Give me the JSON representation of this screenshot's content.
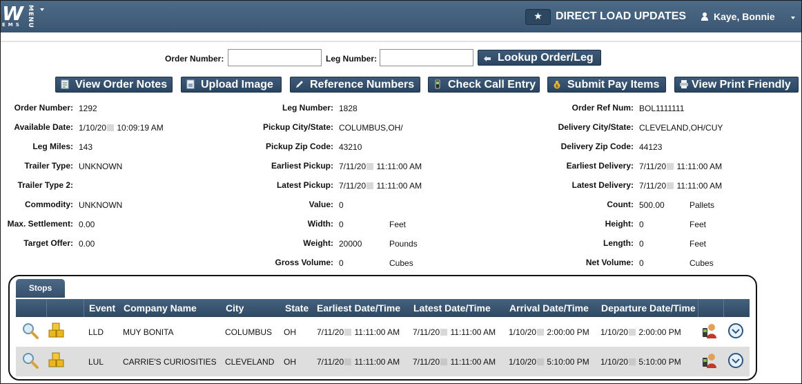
{
  "header": {
    "logo_text": "W",
    "logo_subtext": "EMS",
    "menu_label": "MENU",
    "title": "DIRECT LOAD UPDATES",
    "user_name": "Kaye, Bonnie"
  },
  "lookup": {
    "order_number_label": "Order Number:",
    "order_number_value": "",
    "leg_number_label": "Leg Number:",
    "leg_number_value": "",
    "lookup_button_label": "Lookup Order/Leg"
  },
  "actions": {
    "view_order_notes": "View Order Notes",
    "upload_image": "Upload Image",
    "reference_numbers": "Reference Numbers",
    "check_call_entry": "Check Call Entry",
    "submit_pay_items": "Submit Pay Items",
    "view_print_friendly": "View Print Friendly"
  },
  "details": {
    "left": [
      {
        "label": "Order Number:",
        "value": "1292"
      },
      {
        "label": "Available Date:",
        "value_pre": "1/10/20",
        "value_post": " 10:09:19 AM"
      },
      {
        "label": "Leg Miles:",
        "value": "143"
      },
      {
        "label": "Trailer Type:",
        "value": "UNKNOWN"
      },
      {
        "label": "Trailer Type 2:",
        "value": ""
      },
      {
        "label": "Commodity:",
        "value": "UNKNOWN"
      },
      {
        "label": "Max. Settlement:",
        "value": "0.00"
      },
      {
        "label": "Target Offer:",
        "value": "0.00"
      }
    ],
    "middle": [
      {
        "label": "Leg Number:",
        "value": "1828"
      },
      {
        "label": "Pickup City/State:",
        "value": "COLUMBUS,OH/"
      },
      {
        "label": "Pickup Zip Code:",
        "value": "43210"
      },
      {
        "label": "Earliest Pickup:",
        "value_pre": "7/11/20",
        "value_post": " 11:11:00 AM"
      },
      {
        "label": "Latest Pickup:",
        "value_pre": "7/11/20",
        "value_post": " 11:11:00 AM"
      },
      {
        "label": "Value:",
        "value": "0"
      },
      {
        "label": "Width:",
        "value": "0",
        "unit": "Feet"
      },
      {
        "label": "Weight:",
        "value": "20000",
        "unit": "Pounds"
      },
      {
        "label": "Gross Volume:",
        "value": "0",
        "unit": "Cubes"
      }
    ],
    "right": [
      {
        "label": "Order Ref Num:",
        "value": "BOL1111111"
      },
      {
        "label": "Delivery City/State:",
        "value": "CLEVELAND,OH/CUY"
      },
      {
        "label": "Delivery Zip Code:",
        "value": "44123"
      },
      {
        "label": "Earliest Delivery:",
        "value_pre": "7/11/20",
        "value_post": " 11:11:00 AM"
      },
      {
        "label": "Latest Delivery:",
        "value_pre": "7/11/20",
        "value_post": " 11:11:00 AM"
      },
      {
        "label": "Count:",
        "value": "500.00",
        "unit": "Pallets"
      },
      {
        "label": "Height:",
        "value": "0",
        "unit": "Feet"
      },
      {
        "label": "Length:",
        "value": "0",
        "unit": "Feet"
      },
      {
        "label": "Net Volume:",
        "value": "0",
        "unit": "Cubes"
      }
    ]
  },
  "stops": {
    "tab_label": "Stops",
    "columns": [
      "Event",
      "Company Name",
      "City",
      "State",
      "Earliest Date/Time",
      "Latest Date/Time",
      "Arrival Date/Time",
      "Departure Date/Time"
    ],
    "rows": [
      {
        "event": "LLD",
        "company": "MUY BONITA",
        "city": "COLUMBUS",
        "state": "OH",
        "earliest_pre": "7/11/20",
        "earliest_post": " 11:11:00 AM",
        "latest_pre": "7/11/20",
        "latest_post": " 11:11:00 AM",
        "arrival_pre": "1/10/20",
        "arrival_post": " 2:00:00 PM",
        "departure_pre": "1/10/20",
        "departure_post": " 2:00:00 PM"
      },
      {
        "event": "LUL",
        "company": "CARRIE'S CURIOSITIES",
        "city": "CLEVELAND",
        "state": "OH",
        "earliest_pre": "7/11/20",
        "earliest_post": " 11:11:00 AM",
        "latest_pre": "7/11/20",
        "latest_post": " 11:11:00 AM",
        "arrival_pre": "1/10/20",
        "arrival_post": " 5:10:00 PM",
        "departure_pre": "1/10/20",
        "departure_post": " 5:10:00 PM"
      }
    ]
  },
  "colors": {
    "header_bg": "#3f5b77",
    "button_bg": "#2f4a66",
    "grid_header_bg": "#3a5572",
    "alt_row_bg": "#dedede"
  }
}
